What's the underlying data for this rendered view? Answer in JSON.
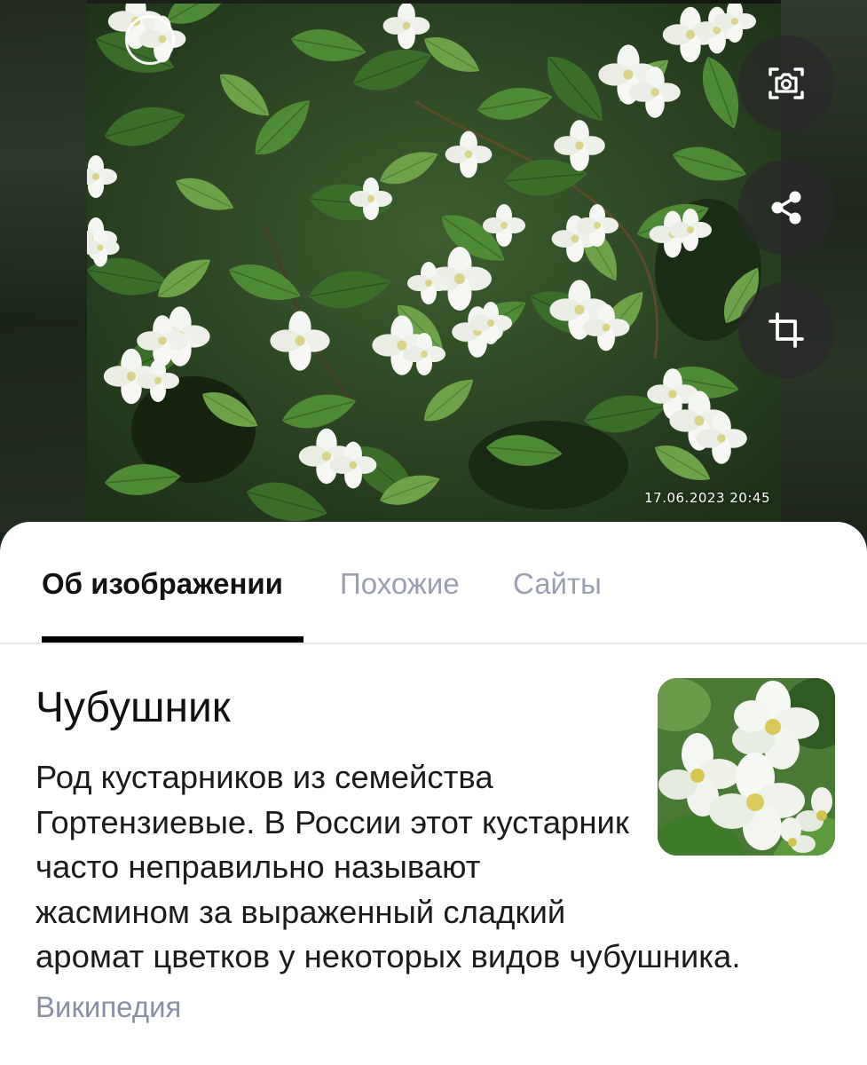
{
  "photo": {
    "timestamp": "17.06.2023  20:45",
    "subject": "jasmine-shrub-photo"
  },
  "actions": [
    {
      "name": "camera-search",
      "icon": "camera-lens-icon"
    },
    {
      "name": "share",
      "icon": "share-icon"
    },
    {
      "name": "crop",
      "icon": "crop-icon"
    }
  ],
  "tabs": [
    {
      "label": "Об изображении",
      "active": true
    },
    {
      "label": "Похожие",
      "active": false
    },
    {
      "label": "Сайты",
      "active": false
    }
  ],
  "result": {
    "title": "Чубушник",
    "description": "Род кустарников из семейства Гортензиевые. В России этот кустарник часто неправильно называют жасмином за выраженный сладкий аромат цветков у некоторых видов чубушника.",
    "source": "Википедия",
    "thumbnail": "philadelphus-flowers-thumbnail"
  },
  "colors": {
    "tab_active": "#121212",
    "tab_inactive": "#9aa0b2",
    "source_text": "#8a90a3",
    "button_bg": "rgba(40,40,40,0.72)"
  }
}
